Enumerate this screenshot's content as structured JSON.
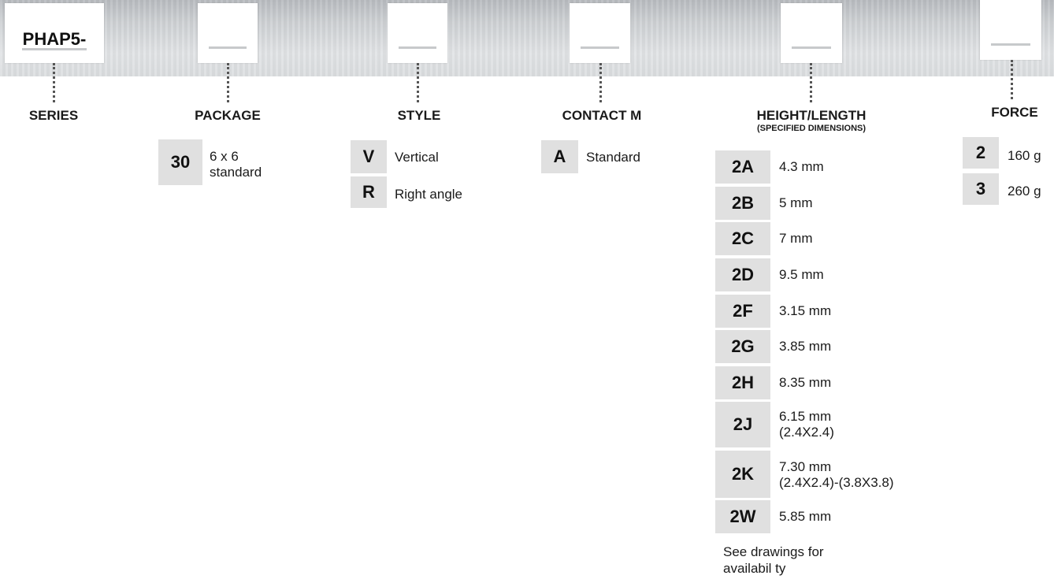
{
  "series": {
    "code": "PHAP5-",
    "label": "SERIES"
  },
  "package": {
    "label": "PACKAGE",
    "options": [
      {
        "code": "30",
        "desc1": "6 x 6",
        "desc2": "standard"
      }
    ]
  },
  "style": {
    "label": "STYLE",
    "options": [
      {
        "code": "V",
        "desc": "Vertical"
      },
      {
        "code": "R",
        "desc": "Right angle"
      }
    ]
  },
  "contact": {
    "label": "CONTACT M",
    "options": [
      {
        "code": "A",
        "desc": "Standard"
      }
    ]
  },
  "height": {
    "label": "HEIGHT/LENGTH",
    "sublabel": "(SPECIFIED DIMENSIONS)",
    "options": [
      {
        "code": "2A",
        "desc1": "4.3 mm",
        "desc2": ""
      },
      {
        "code": "2B",
        "desc1": "5 mm",
        "desc2": ""
      },
      {
        "code": "2C",
        "desc1": "7 mm",
        "desc2": ""
      },
      {
        "code": "2D",
        "desc1": "9.5 mm",
        "desc2": ""
      },
      {
        "code": "2F",
        "desc1": "3.15 mm",
        "desc2": ""
      },
      {
        "code": "2G",
        "desc1": "3.85 mm",
        "desc2": ""
      },
      {
        "code": "2H",
        "desc1": "8.35 mm",
        "desc2": ""
      },
      {
        "code": "2J",
        "desc1": "6.15 mm",
        "desc2": "(2.4X2.4)"
      },
      {
        "code": "2K",
        "desc1": "7.30 mm",
        "desc2": "(2.4X2.4)-(3.8X3.8)"
      },
      {
        "code": "2W",
        "desc1": "5.85 mm",
        "desc2": ""
      }
    ],
    "note1": "See drawings for",
    "note2": "availabil ty"
  },
  "force": {
    "label": "FORCE",
    "options": [
      {
        "code": "2",
        "desc": "160 g"
      },
      {
        "code": "3",
        "desc": "260 g"
      }
    ]
  }
}
